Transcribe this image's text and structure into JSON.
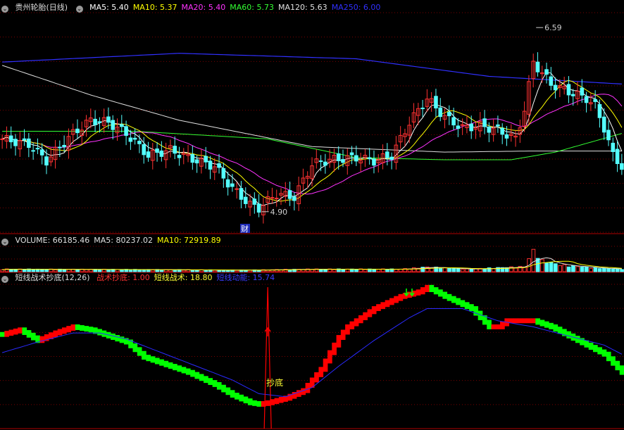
{
  "colors": {
    "up": "#ff3232",
    "down": "#54ffff",
    "grid": "#7a0000",
    "ma5": "#ffffff",
    "ma10": "#ffff00",
    "ma20": "#ff33ff",
    "ma60": "#33ff33",
    "ma120": "#e0e0e0",
    "ma250": "#3030ff",
    "green_bar": "#00ff00",
    "red_bar": "#ff0000",
    "blue_line": "#2a2aff",
    "label_yellow": "#ffff33"
  },
  "icons": {
    "collapse": "circle-chevron-icon",
    "buy_arrow": "arrow-up-icon",
    "sell_arrows": "double-arrow-down-icon"
  },
  "price_panel": {
    "title": "贵州轮胎(日线)",
    "legend": [
      {
        "label": "MA5: 5.40",
        "color": "#ffffff"
      },
      {
        "label": "MA10: 5.37",
        "color": "#ffff00"
      },
      {
        "label": "MA20: 5.40",
        "color": "#ff33ff"
      },
      {
        "label": "MA60: 5.73",
        "color": "#33ff33"
      },
      {
        "label": "MA120: 5.63",
        "color": "#e0e0e0"
      },
      {
        "label": "MA250: 6.00",
        "color": "#3030ff"
      }
    ],
    "high_label": "6.59",
    "low_label": "4.90",
    "event_marker": "财"
  },
  "volume_panel": {
    "legend": [
      {
        "label": "VOLUME: 66185.46",
        "color": "#e0e0e0"
      },
      {
        "label": "MA5: 80237.02",
        "color": "#e0e0e0"
      },
      {
        "label": "MA10: 72919.89",
        "color": "#ffff00"
      }
    ]
  },
  "indicator_panel": {
    "title": "短线战术抄底(12,26)",
    "legend": [
      {
        "label": "战术抄底: 1.00",
        "color": "#ff3232"
      },
      {
        "label": "短线战术: 18.80",
        "color": "#ffff33"
      },
      {
        "label": "短线动能: 15.74",
        "color": "#3c3cff"
      }
    ],
    "signal_label": "抄底"
  },
  "chart_data": [
    {
      "type": "candlestick",
      "title": "贵州轮胎(日线)",
      "ylim": [
        4.7,
        6.7
      ],
      "annotations": [
        {
          "text": "6.59",
          "value": 6.59
        },
        {
          "text": "4.90",
          "value": 4.9
        }
      ],
      "anchors": [
        [
          0,
          5.55
        ],
        [
          6,
          5.5
        ],
        [
          10,
          5.35
        ],
        [
          16,
          5.6
        ],
        [
          20,
          5.72
        ],
        [
          24,
          5.7
        ],
        [
          28,
          5.6
        ],
        [
          33,
          5.4
        ],
        [
          38,
          5.45
        ],
        [
          42,
          5.38
        ],
        [
          48,
          5.3
        ],
        [
          52,
          5.1
        ],
        [
          56,
          4.95
        ],
        [
          58,
          4.92
        ],
        [
          62,
          5.05
        ],
        [
          66,
          5.02
        ],
        [
          70,
          5.32
        ],
        [
          74,
          5.36
        ],
        [
          80,
          5.38
        ],
        [
          84,
          5.35
        ],
        [
          88,
          5.4
        ],
        [
          92,
          5.7
        ],
        [
          96,
          5.92
        ],
        [
          100,
          5.75
        ],
        [
          104,
          5.65
        ],
        [
          108,
          5.67
        ],
        [
          112,
          5.63
        ],
        [
          116,
          5.55
        ],
        [
          118,
          5.82
        ],
        [
          120,
          6.25
        ],
        [
          124,
          6.05
        ],
        [
          128,
          5.98
        ],
        [
          132,
          5.92
        ],
        [
          134,
          5.85
        ],
        [
          136,
          5.65
        ],
        [
          138,
          5.4
        ],
        [
          140,
          5.3
        ]
      ]
    },
    {
      "type": "bar",
      "title": "VOLUME",
      "ylim": [
        0,
        300000
      ],
      "anchors": [
        [
          0,
          30000
        ],
        [
          30,
          25000
        ],
        [
          55,
          18000
        ],
        [
          70,
          30000
        ],
        [
          90,
          30000
        ],
        [
          96,
          55000
        ],
        [
          105,
          30000
        ],
        [
          118,
          60000
        ],
        [
          120,
          250000
        ],
        [
          122,
          130000
        ],
        [
          126,
          80000
        ],
        [
          135,
          40000
        ],
        [
          140,
          30000
        ]
      ]
    },
    {
      "type": "area",
      "title": "短线战术抄底(12,26)",
      "ylim": [
        -5,
        90
      ],
      "fast_anchors": [
        [
          0,
          57
        ],
        [
          4,
          60
        ],
        [
          8,
          53
        ],
        [
          12,
          58
        ],
        [
          16,
          62
        ],
        [
          20,
          60
        ],
        [
          24,
          56
        ],
        [
          28,
          52
        ],
        [
          32,
          42
        ],
        [
          36,
          38
        ],
        [
          42,
          32
        ],
        [
          48,
          24
        ],
        [
          52,
          17
        ],
        [
          56,
          12
        ],
        [
          58,
          11
        ],
        [
          60,
          12
        ],
        [
          64,
          15
        ],
        [
          68,
          20
        ],
        [
          72,
          34
        ],
        [
          74,
          45
        ],
        [
          76,
          55
        ],
        [
          78,
          62
        ],
        [
          84,
          74
        ],
        [
          90,
          82
        ],
        [
          94,
          85
        ],
        [
          96,
          88
        ],
        [
          100,
          82
        ],
        [
          106,
          74
        ],
        [
          110,
          62
        ],
        [
          112,
          62
        ],
        [
          114,
          66
        ],
        [
          116,
          66
        ],
        [
          120,
          66
        ],
        [
          124,
          62
        ],
        [
          128,
          56
        ],
        [
          132,
          50
        ],
        [
          136,
          44
        ],
        [
          140,
          32
        ]
      ],
      "slow_anchors": [
        [
          0,
          45
        ],
        [
          8,
          52
        ],
        [
          16,
          58
        ],
        [
          22,
          58
        ],
        [
          28,
          54
        ],
        [
          36,
          45
        ],
        [
          44,
          36
        ],
        [
          52,
          27
        ],
        [
          58,
          18
        ],
        [
          64,
          16
        ],
        [
          70,
          22
        ],
        [
          76,
          36
        ],
        [
          84,
          53
        ],
        [
          92,
          68
        ],
        [
          96,
          74
        ],
        [
          104,
          74
        ],
        [
          112,
          66
        ],
        [
          120,
          62
        ],
        [
          128,
          56
        ],
        [
          136,
          50
        ],
        [
          140,
          44
        ]
      ],
      "signal": {
        "x": 60,
        "value": 1.0
      }
    }
  ]
}
